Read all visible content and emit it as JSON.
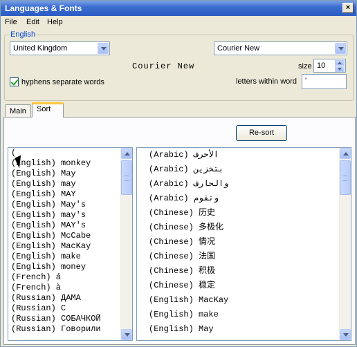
{
  "window": {
    "title": "Languages & Fonts",
    "close_label": "×"
  },
  "menu": {
    "items": [
      "File",
      "Edit",
      "Help"
    ]
  },
  "group": {
    "label": "English",
    "locale_value": "United Kingdom",
    "font_value": "Courier New",
    "preview_text": "Courier New",
    "hyphens_label": "hyphens separate words",
    "hyphens_checked": true,
    "size_label": "size",
    "size_value": "10",
    "letters_label": "letters within word",
    "letters_value": "'"
  },
  "tabs": [
    {
      "label": "Main",
      "active": false
    },
    {
      "label": "Sort",
      "active": true
    }
  ],
  "sort": {
    "resort_label": "Re-sort",
    "left_list": [
      "(",
      "(English) monkey",
      "(English) May",
      "(English) may",
      "(English) MAY",
      "(English) May's",
      "(English) may's",
      "(English) MAY's",
      "(English) McCabe",
      "(English) MacKay",
      "(English) make",
      "(English) money",
      "(French) á",
      "(French) à",
      "(Russian) ДАМА",
      "(Russian) С",
      "(Russian) СОБАЧКОЙ",
      "(Russian) Говорили"
    ],
    "right_list": [
      "(Arabic)  الأحرف",
      "(Arabic)  بتخزين",
      "(Arabic)  والحارف",
      "(Arabic)  وتقوم",
      "(Chinese) 历史",
      "(Chinese) 多极化",
      "(Chinese) 情况",
      "(Chinese) 法国",
      "(Chinese) 积极",
      "(Chinese) 稳定",
      "(English) MacKay",
      "(English) make",
      "(English) May"
    ]
  }
}
